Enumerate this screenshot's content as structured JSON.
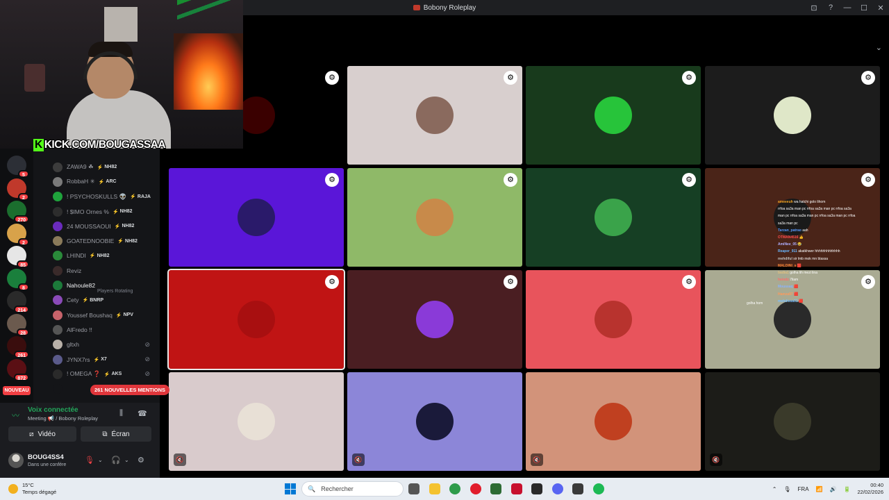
{
  "window": {
    "title": "Bobony Roleplay",
    "controls": [
      "⊡",
      "?",
      "—",
      "☐",
      "✕"
    ]
  },
  "stream_overlay": {
    "kick_k": "K",
    "kick_url": "KICK.COM/BOUGASSAA"
  },
  "servers": [
    {
      "badge": "5",
      "color": "#2c2f36"
    },
    {
      "badge": "2",
      "color": "#c0392b"
    },
    {
      "badge": "270",
      "color": "#1b6e2e"
    },
    {
      "badge": "2",
      "color": "#d8a24a"
    },
    {
      "badge": "85",
      "color": "#e6e6e6"
    },
    {
      "badge": "8",
      "color": "#1a7f3c"
    },
    {
      "badge": "214",
      "color": "#2a2a2a"
    },
    {
      "badge": "28",
      "color": "#6b5a4e"
    },
    {
      "badge": "261",
      "color": "#3a0d0d"
    },
    {
      "badge": "872",
      "color": "#5a0f14"
    }
  ],
  "nouveau_label": "NOUVEAU",
  "channel": {
    "section_label": "Players Rotating",
    "members": [
      {
        "name": "ZAWA9 ☘",
        "tag": "NH82",
        "color": "#3c3c3c",
        "muted": false
      },
      {
        "name": "RobbaH ✳",
        "tag": "ARC",
        "color": "#7a7a7a",
        "muted": false
      },
      {
        "name": "! PSYCHOSKULLS 👽",
        "tag": "RAJA",
        "color": "#1fa33c",
        "muted": false
      },
      {
        "name": "! $IMO Ornes %",
        "tag": "NH82",
        "color": "#2d2d2d",
        "muted": false
      },
      {
        "name": "24 MOUSSAOUI",
        "tag": "NH82",
        "color": "#6a2bbd",
        "muted": false
      },
      {
        "name": "GOATEDNOOBIE",
        "tag": "NH82",
        "color": "#8a7a5a",
        "muted": false
      },
      {
        "name": "LHINDI",
        "tag": "NH82",
        "color": "#2a8a3a",
        "muted": false
      },
      {
        "name": "Reviz",
        "tag": "",
        "color": "#3a2a2a",
        "muted": false
      },
      {
        "name": "Nahoule82",
        "tag": "",
        "color": "#1c7a3a",
        "muted": false
      },
      {
        "name": "Cety",
        "tag": "BNRP",
        "color": "#8a4ab8",
        "muted": false
      },
      {
        "name": "Youssef Boushaq",
        "tag": "NPV",
        "color": "#c7636b",
        "muted": false
      },
      {
        "name": "AlFredo !!",
        "tag": "",
        "color": "#555555",
        "muted": false
      },
      {
        "name": "gltxh",
        "tag": "",
        "color": "#b8b0a8",
        "muted": true
      },
      {
        "name": "JYNX7rs",
        "tag": "X7",
        "color": "#5a5a8a",
        "muted": true
      },
      {
        "name": "! OMEGA ❓",
        "tag": "AKS",
        "color": "#2a2a2a",
        "muted": true
      },
      {
        "name": "",
        "tag": "",
        "color": "#141518",
        "muted": true
      }
    ],
    "mentions_label": "261 NOUVELLES MENTIONS"
  },
  "voice": {
    "status": "Voix connectée",
    "sub": "Meeting 📢 / Bobony Roleplay",
    "video_label": "Vidéo",
    "screen_label": "Écran"
  },
  "user": {
    "name": "BOUG4SS4",
    "status": "Dans une confére"
  },
  "tiles": [
    {
      "bg": "#000000",
      "avatar": "#3a0000",
      "muted": false
    },
    {
      "bg": "#d8cfce",
      "avatar": "#8a6a5e",
      "muted": false
    },
    {
      "bg": "#183a1c",
      "avatar": "#27c43a",
      "muted": false
    },
    {
      "bg": "#1c1c1c",
      "avatar": "#dfe7c8",
      "muted": false
    },
    {
      "bg": "#5a16d8",
      "avatar": "#2a1a6a",
      "muted": false
    },
    {
      "bg": "#8fb968",
      "avatar": "#c88a4a",
      "muted": false
    },
    {
      "bg": "#163f24",
      "avatar": "#3aa34a",
      "muted": false
    },
    {
      "bg": "#4a2418",
      "avatar": "#1a1a1a",
      "muted": false
    },
    {
      "bg": "#c01414",
      "avatar": "#a80f10",
      "muted": false
    },
    {
      "bg": "#4a1e22",
      "avatar": "#8a3ad8",
      "muted": false
    },
    {
      "bg": "#e8545c",
      "avatar": "#b8332e",
      "muted": false
    },
    {
      "bg": "#a9aa92",
      "avatar": "#2a2a2a",
      "muted": false
    },
    {
      "bg": "#d9cbcc",
      "avatar": "#e8e0d6",
      "muted": true
    },
    {
      "bg": "#8c86d8",
      "avatar": "#1a1a3a",
      "muted": true
    },
    {
      "bg": "#d2937a",
      "avatar": "#c04020",
      "muted": true
    },
    {
      "bg": "#1c1c18",
      "avatar": "#3a3a2a",
      "muted": true
    }
  ],
  "chat_overlay": {
    "lines": [
      {
        "user": "ameeeuh",
        "msg": "wa hatchi golo lihom",
        "ucolor": "#f5a623"
      },
      {
        "user": "",
        "msg": "rrfoa sa3a man pc rrfoa sa3a man pc rrfoa sa3a",
        "ucolor": "#ffffff"
      },
      {
        "user": "",
        "msg": "man pc rrfoa sa3a man pc rrfoa sa3a man pc rrfoa",
        "ucolor": "#ffffff"
      },
      {
        "user": "",
        "msg": "sa3a man pc",
        "ucolor": "#ffffff"
      },
      {
        "user": "Tarzan_patrao",
        "msg": "aah",
        "ucolor": "#5b9bff"
      },
      {
        "user": "OTMAN4516",
        "msg": "👍",
        "ucolor": "#ff4d4d"
      },
      {
        "user": "AmiNee_05",
        "msg": "😂",
        "ucolor": "#b0b0ff"
      },
      {
        "user": "Reaper_911",
        "msg": "akatkhwer hhhhhhhhhhhhh",
        "ucolor": "#6ab8ff"
      },
      {
        "user": "mehdiful",
        "msg": "sir lmb mok mn blassa",
        "ucolor": "#c0c0c0"
      },
      {
        "user": "MALDINI_s",
        "msg": "🟥",
        "ucolor": "#ff8a3a"
      },
      {
        "user": "badia1",
        "msg": "golha lih mezi lina",
        "ucolor": "#e0c080"
      },
      {
        "user": "heindz",
        "msg": "7ilam",
        "ucolor": "#ff6a6a"
      },
      {
        "user": "Moussaq",
        "msg": "🟥",
        "ucolor": "#8ab4ff"
      },
      {
        "user": "Hamza97",
        "msg": "🟥",
        "ucolor": "#ff9a5a"
      },
      {
        "user": "mehdissa01",
        "msg": "🟥",
        "ucolor": "#7ac0ff"
      }
    ],
    "extra": "golha hom"
  },
  "taskbar": {
    "weather_temp": "15°C",
    "weather_desc": "Temps dégagé",
    "search_placeholder": "Rechercher",
    "lang": "FRA",
    "time": "00:40",
    "date": "22/02/2026",
    "apps": [
      {
        "name": "task-view-icon",
        "color": "#555555"
      },
      {
        "name": "file-explorer-icon",
        "color": "#f4c22f"
      },
      {
        "name": "chrome-icon",
        "color": "#2e9b4a"
      },
      {
        "name": "opera-icon",
        "color": "#e11d2c"
      },
      {
        "name": "terminal-icon",
        "color": "#2d6b34"
      },
      {
        "name": "adobe-icon",
        "color": "#c8102e"
      },
      {
        "name": "obs-icon",
        "color": "#2a2a2a"
      },
      {
        "name": "discord-icon",
        "color": "#5865f2"
      },
      {
        "name": "media-icon",
        "color": "#3a3a3a"
      },
      {
        "name": "spotify-icon",
        "color": "#1db954"
      }
    ]
  }
}
